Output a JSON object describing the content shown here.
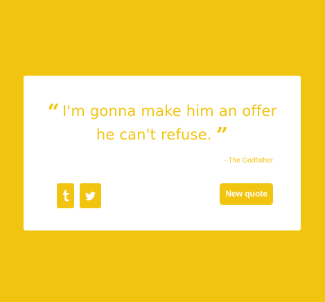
{
  "quote": {
    "open_mark": "“",
    "text": "I'm gonna make him an offer he can't refuse.",
    "close_mark": "”",
    "author": "- The Godfather"
  },
  "share": {
    "tumblr_icon": "tumblr-icon",
    "twitter_icon": "twitter-icon"
  },
  "actions": {
    "new_quote_label": "New quote"
  },
  "colors": {
    "accent": "#f1c40f",
    "card": "#ffffff"
  }
}
